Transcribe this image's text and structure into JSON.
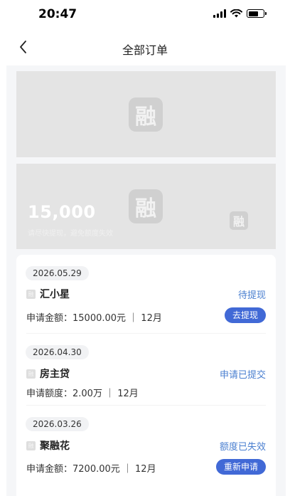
{
  "status_bar": {
    "time": "20:47"
  },
  "nav": {
    "title": "全部订单"
  },
  "banners": {
    "watermark": "融",
    "promo_amount": "15,000",
    "promo_subtitle": "请尽快提现，避免额度失效"
  },
  "orders": [
    {
      "date": "2026.05.29",
      "product_name": "汇小星",
      "status": "待提现",
      "info": "申请金额：15000.00元 ｜ 12月",
      "action": "去提现"
    },
    {
      "date": "2026.04.30",
      "product_name": "房主贷",
      "status": "申请已提交",
      "info": "申请额度：2.00万 ｜ 12月",
      "action": null
    },
    {
      "date": "2026.03.26",
      "product_name": "聚融花",
      "status": "额度已失效",
      "info": "申请金额：7200.00元 ｜ 12月",
      "action": "重新申请"
    }
  ],
  "colors": {
    "accent": "#4169d6",
    "status_text": "#4a7fd0",
    "page_bg": "#f5f6f8"
  },
  "icons": {
    "back": "chevron-left-icon",
    "signal": "signal-icon",
    "wifi": "wifi-icon",
    "battery": "battery-icon",
    "logo": "app-logo-icon",
    "product": "product-logo-icon"
  }
}
